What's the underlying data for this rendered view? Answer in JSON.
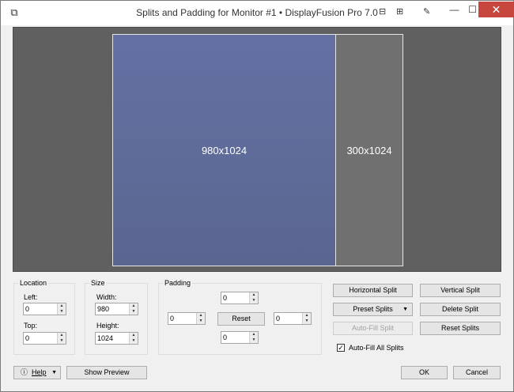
{
  "window": {
    "title": "Splits and Padding for Monitor #1 • DisplayFusion Pro 7.0",
    "close_glyph": "✕",
    "min_glyph": "—",
    "max_glyph": "☐"
  },
  "preview": {
    "split_a_label": "980x1024",
    "split_b_label": "300x1024"
  },
  "location": {
    "title": "Location",
    "left_label": "Left:",
    "left_value": "0",
    "top_label": "Top:",
    "top_value": "0"
  },
  "size": {
    "title": "Size",
    "width_label": "Width:",
    "width_value": "980",
    "height_label": "Height:",
    "height_value": "1024"
  },
  "padding": {
    "title": "Padding",
    "top_value": "0",
    "left_value": "0",
    "right_value": "0",
    "bottom_value": "0",
    "reset_label": "Reset"
  },
  "actions": {
    "horizontal_split": "Horizontal Split",
    "vertical_split": "Vertical Split",
    "preset_splits": "Preset Splits",
    "delete_split": "Delete Split",
    "auto_fill_split": "Auto-Fill Split",
    "reset_splits": "Reset Splits",
    "auto_fill_all_label": "Auto-Fill All Splits",
    "auto_fill_all_checked": true
  },
  "footer": {
    "help_label": "Help",
    "show_preview_label": "Show Preview",
    "ok_label": "OK",
    "cancel_label": "Cancel"
  }
}
